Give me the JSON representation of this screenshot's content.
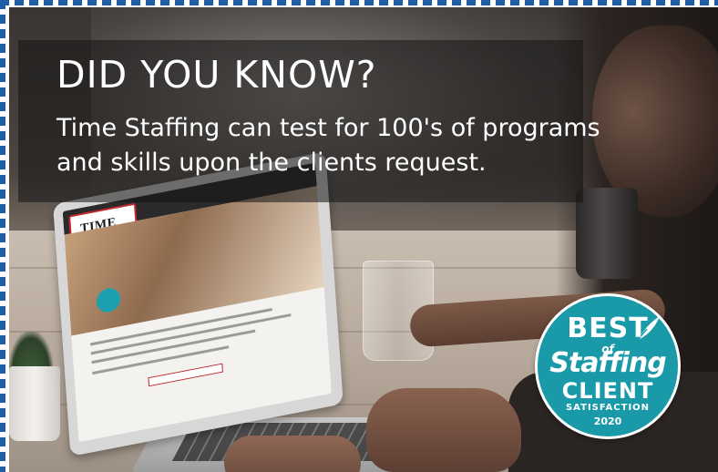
{
  "ad": {
    "headline": "DID YOU KNOW?",
    "subline_1": "Time Staffing can test for 100's of programs",
    "subline_2": "and skills upon the clients request."
  },
  "laptop_site": {
    "logo_text": "TIME"
  },
  "badge": {
    "best": "BEST",
    "of": "of",
    "staffing": "Staffing",
    "client": "CLIENT",
    "satisfaction": "SATISFACTION",
    "year": "2020",
    "icon": "quill-icon"
  },
  "colors": {
    "border": "#1f5fa8",
    "badge": "#1a9aa8",
    "text": "#ffffff"
  }
}
